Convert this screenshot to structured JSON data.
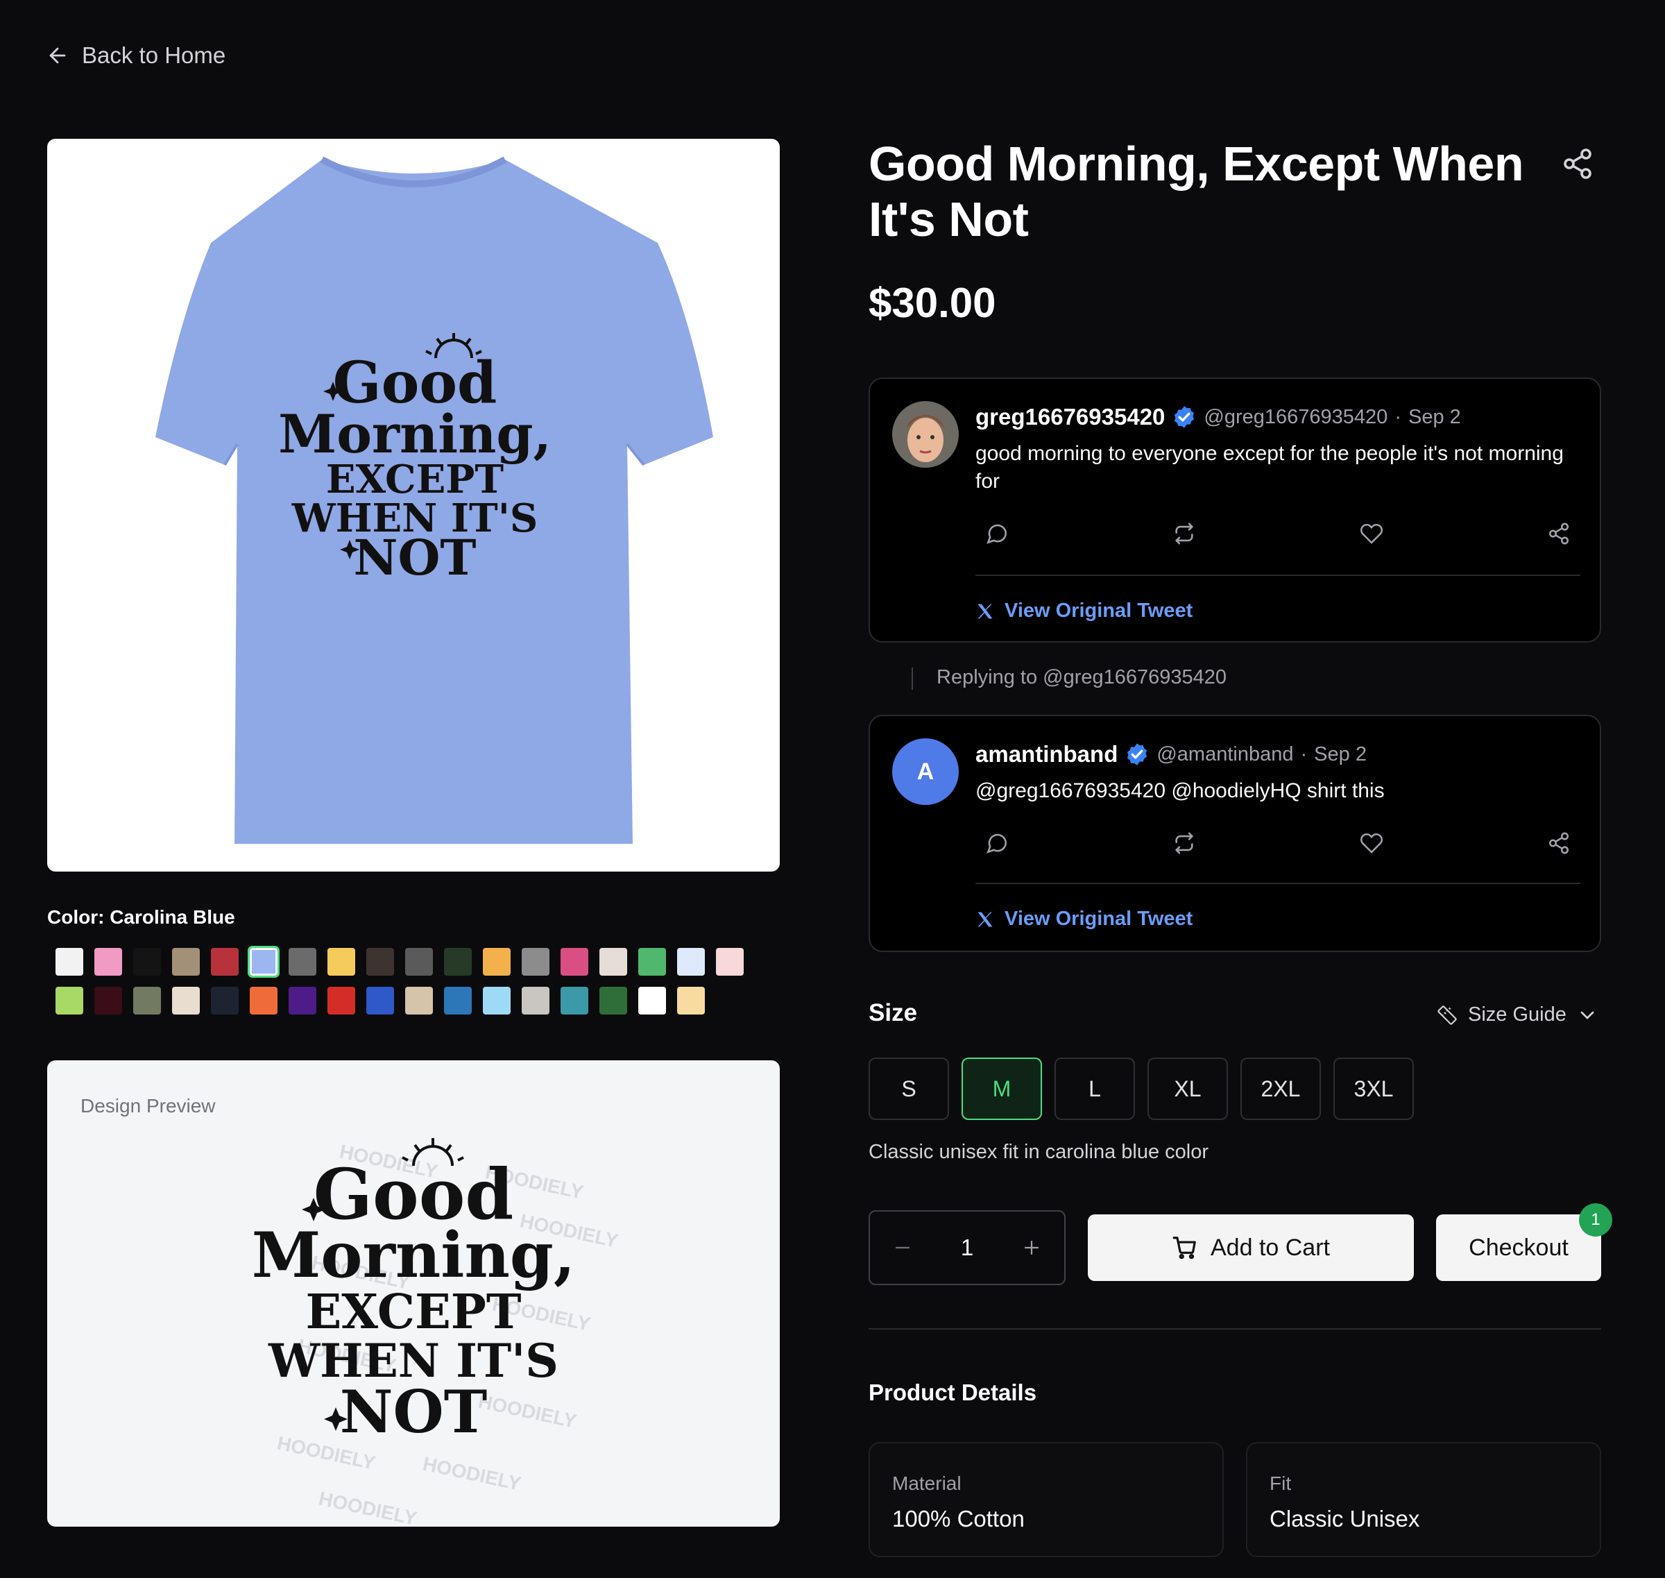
{
  "nav": {
    "back_label": "Back to Home"
  },
  "product": {
    "title": "Good Morning, Except When It's Not",
    "price": "$30.00",
    "shirt_color_hex": "#8fa8e6",
    "design_text": [
      "Good",
      "Morning,",
      "EXCEPT",
      "WHEN IT'S",
      "NOT"
    ],
    "watermark": "HOODIELY"
  },
  "color": {
    "label": "Color: Carolina Blue",
    "selected": "Carolina Blue",
    "swatches": [
      "#f2f2f2",
      "#f19ac4",
      "#141414",
      "#a39078",
      "#b8323c",
      "#9bb6f0",
      "#6b6b6b",
      "#f5cb5c",
      "#3d3431",
      "#5a5a5a",
      "#263a27",
      "#f2b14a",
      "#8c8c8c",
      "#d94f84",
      "#e6dcd8",
      "#4fb86e",
      "#deeafc",
      "#f8d8d8",
      "#a8d866",
      "#3a0d18",
      "#737a62",
      "#e9ddd0",
      "#1d2330",
      "#ef6c3a",
      "#4d1c86",
      "#d42d27",
      "#2f58c9",
      "#d5c4a9",
      "#2d76b8",
      "#9edaf6",
      "#c9c5c0",
      "#3c9aa8",
      "#2f6e38",
      "#ffffff",
      "#f7dba0"
    ]
  },
  "design_preview": {
    "label": "Design Preview"
  },
  "tweets": [
    {
      "name": "greg16676935420",
      "handle": "@greg16676935420",
      "date": "Sep 2",
      "text": "good morning to everyone except for the people it's not morning for",
      "view_label": "View Original Tweet"
    },
    {
      "avatar_letter": "A",
      "name": "amantinband",
      "handle": "@amantinband",
      "date": "Sep 2",
      "text": "@greg16676935420 @hoodielyHQ shirt this",
      "view_label": "View Original Tweet"
    }
  ],
  "replying_label": "Replying to @greg16676935420",
  "size": {
    "heading": "Size",
    "guide_label": "Size Guide",
    "options": [
      "S",
      "M",
      "L",
      "XL",
      "2XL",
      "3XL"
    ],
    "selected": "M",
    "description": "Classic unisex fit in carolina blue color"
  },
  "purchase": {
    "quantity": "1",
    "add_to_cart_label": "Add to Cart",
    "checkout_label": "Checkout",
    "cart_badge": "1"
  },
  "details": {
    "heading": "Product Details",
    "items": [
      {
        "key": "Material",
        "value": "100% Cotton"
      },
      {
        "key": "Fit",
        "value": "Classic Unisex"
      }
    ]
  }
}
